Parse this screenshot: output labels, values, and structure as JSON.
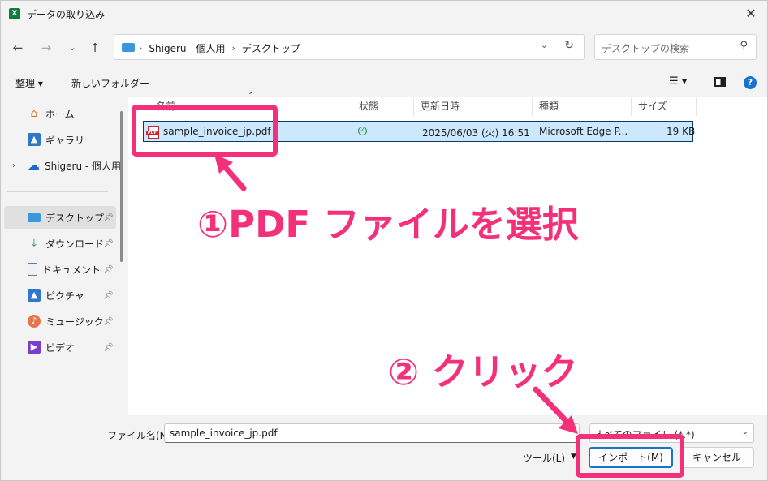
{
  "window": {
    "title": "データの取り込み",
    "app_icon_letter": "X"
  },
  "address": {
    "crumbs": [
      "Shigeru - 個人用",
      "デスクトップ"
    ]
  },
  "search": {
    "placeholder": "デスクトップの検索"
  },
  "toolbar": {
    "organize_label": "整理 ▾",
    "new_folder_label": "新しいフォルダー"
  },
  "sidebar": {
    "items": [
      {
        "label": "ホーム",
        "icon": "home-icon"
      },
      {
        "label": "ギャラリー",
        "icon": "gallery-icon"
      },
      {
        "label": "Shigeru - 個人用",
        "icon": "onedrive-icon"
      },
      {
        "label": "デスクトップ",
        "icon": "desktop-icon",
        "pinned": true,
        "selected": true
      },
      {
        "label": "ダウンロード",
        "icon": "download-icon",
        "pinned": true
      },
      {
        "label": "ドキュメント",
        "icon": "document-icon",
        "pinned": true
      },
      {
        "label": "ピクチャ",
        "icon": "pictures-icon",
        "pinned": true
      },
      {
        "label": "ミュージック",
        "icon": "music-icon",
        "pinned": true
      },
      {
        "label": "ビデオ",
        "icon": "video-icon",
        "pinned": true
      }
    ]
  },
  "columns": {
    "name": "名前",
    "status": "状態",
    "modified": "更新日時",
    "type": "種類",
    "size": "サイズ"
  },
  "files": [
    {
      "name": "sample_invoice_jp.pdf",
      "status": "synced",
      "modified": "2025/06/03 (火) 16:51",
      "type": "Microsoft Edge P...",
      "size": "19 KB"
    }
  ],
  "footer": {
    "filename_label": "ファイル名(N):",
    "filename_value": "sample_invoice_jp.pdf",
    "filetype_value": "すべてのファイル (*.*)",
    "tools_label": "ツール(L)",
    "import_label": "インポート(M)",
    "cancel_label": "キャンセル"
  },
  "annotations": {
    "step1": "①PDF ファイルを選択",
    "step2": "② クリック",
    "accent_color": "#f5307a"
  }
}
